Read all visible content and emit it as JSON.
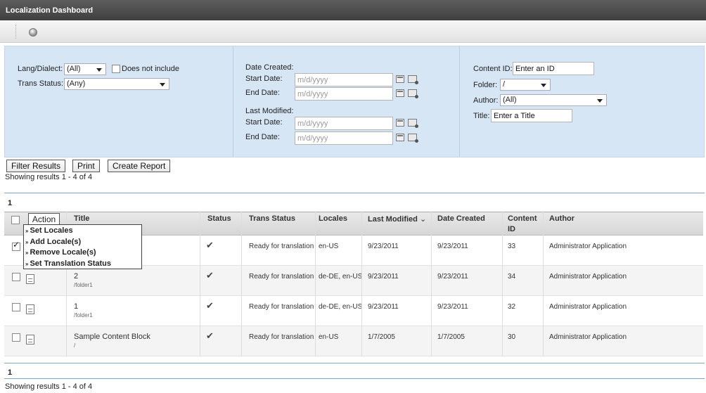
{
  "window": {
    "title": "Localization Dashboard"
  },
  "toolbar": {
    "help_icon": "help-icon"
  },
  "filters": {
    "lang_label": "Lang/Dialect:",
    "lang_value": "(All)",
    "does_not_include_label": "Does not include",
    "trans_status_label": "Trans Status:",
    "trans_status_value": "(Any)",
    "date_created_label": "Date Created:",
    "last_modified_label": "Last Modified:",
    "start_date_label": "Start Date:",
    "end_date_label": "End Date:",
    "date_placeholder": "m/d/yyyy",
    "content_id_label": "Content ID:",
    "content_id_value": "Enter an ID",
    "folder_label": "Folder:",
    "folder_value": "/",
    "author_label": "Author:",
    "author_value": "(All)",
    "title_label": "Title:",
    "title_value": "Enter a Title"
  },
  "buttons": {
    "filter_results": "Filter Results",
    "print": "Print",
    "create_report": "Create Report"
  },
  "results": {
    "summary_top": "Showing results 1 - 4 of 4",
    "summary_bottom": "Showing results 1 - 4 of 4",
    "page_top": "1",
    "page_bottom": "1"
  },
  "grid": {
    "action_label": "Action",
    "columns": {
      "title": "Title",
      "status": "Status",
      "trans_status": "Trans Status",
      "locales": "Locales",
      "last_modified": "Last Modified",
      "sort_indicator": "⌄",
      "date_created": "Date Created",
      "content": "Content",
      "id": "ID",
      "author": "Author"
    },
    "action_menu": [
      "Set Locales",
      "Add Locale(s)",
      "Remove Locale(s)",
      "Set Translation Status"
    ],
    "rows": [
      {
        "checked": true,
        "title": "",
        "path": "",
        "status": "✔",
        "trans_status": "Ready for translation",
        "locales": "en-US",
        "last_modified": "9/23/2011",
        "date_created": "9/23/2011",
        "content_id": "33",
        "author": "Administrator Application"
      },
      {
        "checked": false,
        "title": "2",
        "path": "/folder1",
        "status": "✔",
        "trans_status": "Ready for translation",
        "locales": "de-DE, en-US",
        "last_modified": "9/23/2011",
        "date_created": "9/23/2011",
        "content_id": "34",
        "author": "Administrator Application"
      },
      {
        "checked": false,
        "title": "1",
        "path": "/folder1",
        "status": "✔",
        "trans_status": "Ready for translation",
        "locales": "de-DE, en-US",
        "last_modified": "9/23/2011",
        "date_created": "9/23/2011",
        "content_id": "32",
        "author": "Administrator Application"
      },
      {
        "checked": false,
        "title": "Sample Content Block",
        "path": "/",
        "status": "✔",
        "trans_status": "Ready for translation",
        "locales": "en-US",
        "last_modified": "1/7/2005",
        "date_created": "1/7/2005",
        "content_id": "30",
        "author": "Administrator Application"
      }
    ]
  }
}
